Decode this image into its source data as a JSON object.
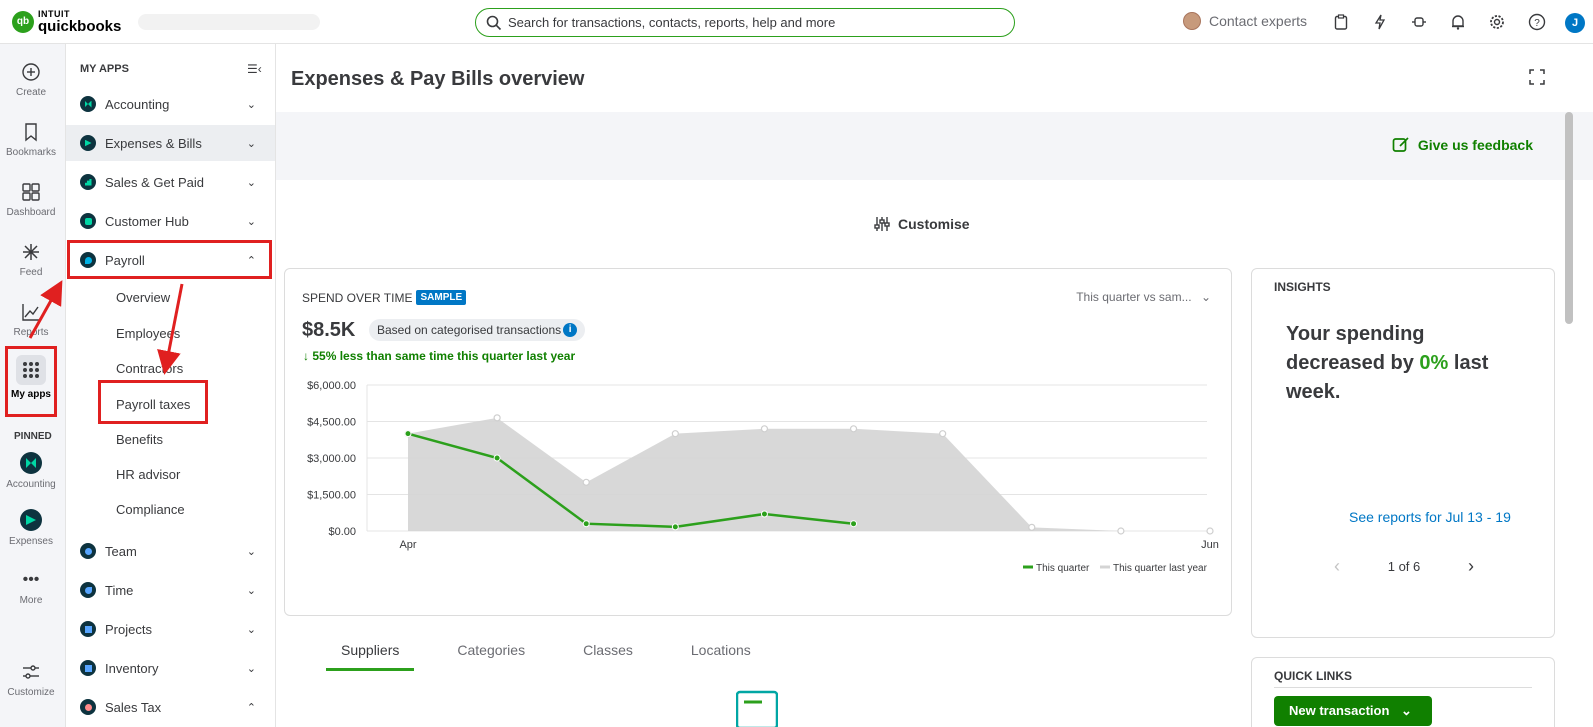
{
  "brand": {
    "intuit": "INTUIT",
    "product": "quickbooks",
    "logo_mark": "qb"
  },
  "search": {
    "placeholder": "Search for transactions, contacts, reports, help and more"
  },
  "header": {
    "contact_label": "Contact experts",
    "user_initial": "J"
  },
  "rail": {
    "items": [
      {
        "label": "Create",
        "icon": "plus-circle-icon"
      },
      {
        "label": "Bookmarks",
        "icon": "bookmark-icon"
      },
      {
        "label": "Dashboard",
        "icon": "dashboard-icon"
      },
      {
        "label": "Feed",
        "icon": "feed-icon"
      },
      {
        "label": "Reports",
        "icon": "reports-icon"
      },
      {
        "label": "My apps",
        "icon": "apps-grid-icon"
      }
    ],
    "pinned_label": "PINNED",
    "pinned": [
      {
        "label": "Accounting"
      },
      {
        "label": "Expenses"
      }
    ],
    "more_label": "More",
    "customize_label": "Customize"
  },
  "sidebar": {
    "header": "MY APPS",
    "items": [
      {
        "label": "Accounting",
        "color": "#00d7a5"
      },
      {
        "label": "Expenses & Bills",
        "color": "#00d7a5"
      },
      {
        "label": "Sales & Get Paid",
        "color": "#00d7a5"
      },
      {
        "label": "Customer Hub",
        "color": "#00d7a5"
      },
      {
        "label": "Payroll",
        "color": "#00b3e6"
      },
      {
        "label": "Team",
        "color": "#57a5ff"
      },
      {
        "label": "Time",
        "color": "#57a5ff"
      },
      {
        "label": "Projects",
        "color": "#57a5ff"
      },
      {
        "label": "Inventory",
        "color": "#57a5ff"
      },
      {
        "label": "Sales Tax",
        "color": "#ff8a8a"
      }
    ],
    "payroll_sub": [
      "Overview",
      "Employees",
      "Contractors",
      "Payroll taxes",
      "Benefits",
      "HR advisor",
      "Compliance"
    ]
  },
  "main": {
    "title": "Expenses & Pay Bills overview",
    "feedback": "Give us feedback",
    "customise": "Customise",
    "tabs": [
      "Suppliers",
      "Categories",
      "Classes",
      "Locations"
    ]
  },
  "spend": {
    "title": "SPEND OVER TIME",
    "badge": "SAMPLE",
    "period": "This quarter vs sam...",
    "total": "$8.5K",
    "basis": "Based on categorised transactions",
    "compare": "55% less than same time this quarter last year"
  },
  "chart_data": {
    "type": "line",
    "y_ticks": [
      "$6,000.00",
      "$4,500.00",
      "$3,000.00",
      "$1,500.00",
      "$0.00"
    ],
    "ylim": [
      0,
      6000
    ],
    "x_tick_labels": [
      {
        "index": 0,
        "label": "Apr"
      },
      {
        "index": 9,
        "label": "Jun"
      }
    ],
    "series": [
      {
        "name": "This quarter",
        "color": "#2ca01c",
        "values": [
          4000,
          3000,
          300,
          170,
          700,
          300
        ]
      },
      {
        "name": "This quarter last year",
        "color": "#d4d4d4",
        "values": [
          4000,
          4650,
          2000,
          4000,
          4200,
          4200,
          4000,
          150,
          0,
          0
        ]
      }
    ]
  },
  "insights": {
    "title": "INSIGHTS",
    "text_before": "Your spending decreased by ",
    "highlight": "0%",
    "text_after": " last week.",
    "link": "See reports for Jul 13 - 19",
    "pager": "1 of 6"
  },
  "quick_links": {
    "title": "QUICK LINKS",
    "new_transaction": "New transaction"
  }
}
